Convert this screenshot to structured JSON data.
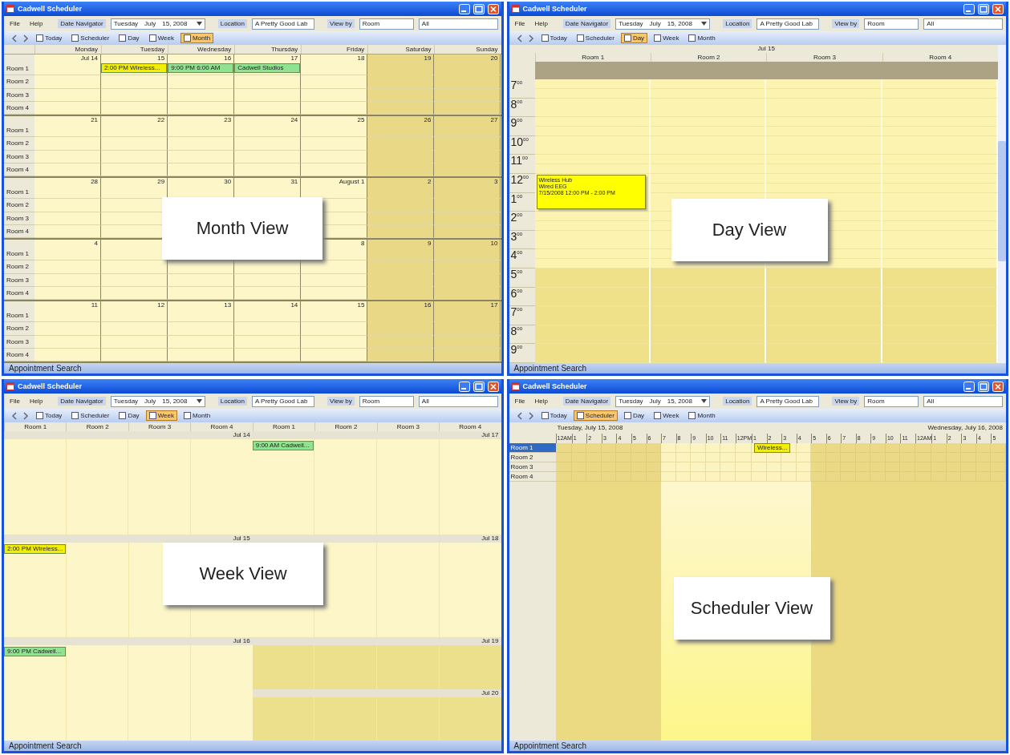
{
  "windows": [
    {
      "title": "Cadwell Scheduler",
      "menu": [
        "File",
        "Help"
      ],
      "date_navigator": {
        "label": "Date Navigator",
        "day": "Tuesday",
        "month": "July",
        "date": "15, 2008"
      },
      "location": {
        "label": "Location",
        "value": "A Pretty Good Lab"
      },
      "view_by": {
        "label": "View by",
        "value": "Room",
        "filter": "All"
      },
      "views": [
        {
          "label": "Today",
          "selected": false
        },
        {
          "label": "Scheduler",
          "selected": false
        },
        {
          "label": "Day",
          "selected": false
        },
        {
          "label": "Week",
          "selected": false
        },
        {
          "label": "Month",
          "selected": true
        }
      ],
      "view": {
        "kind": "month",
        "days": [
          {
            "name": "Monday",
            "weekend": false
          },
          {
            "name": "Tuesday",
            "weekend": false
          },
          {
            "name": "Wednesday",
            "weekend": false
          },
          {
            "name": "Thursday",
            "weekend": false
          },
          {
            "name": "Friday",
            "weekend": false
          },
          {
            "name": "Saturday",
            "weekend": true
          },
          {
            "name": "Sunday",
            "weekend": true
          }
        ],
        "weeks": [
          {
            "dates": [
              "Jul 14",
              "15",
              "16",
              "17",
              "18",
              "19",
              "20"
            ],
            "rooms": [
              {
                "name": "Room 1",
                "cells": [
                  {
                    "kind": "free"
                  },
                  {
                    "kind": "appointment",
                    "text": "2:00 PM Wireless...",
                    "color": "#f2f000"
                  },
                  {
                    "kind": "appointment",
                    "text": "9:00 PM 6:00 AM",
                    "color": "#8fe28f"
                  },
                  {
                    "kind": "appointment",
                    "text": "Cadwell Studios",
                    "color": "#8fe28f"
                  },
                  {
                    "kind": "free"
                  },
                  {
                    "kind": "free"
                  },
                  {
                    "kind": "free"
                  }
                ]
              },
              {
                "name": "Room 2"
              },
              {
                "name": "Room 3"
              },
              {
                "name": "Room 4"
              }
            ]
          },
          {
            "dates": [
              "21",
              "22",
              "23",
              "24",
              "25",
              "26",
              "27"
            ],
            "rooms": [
              {
                "name": "Room 1"
              },
              {
                "name": "Room 2"
              },
              {
                "name": "Room 3"
              },
              {
                "name": "Room 4"
              }
            ]
          },
          {
            "dates": [
              "28",
              "29",
              "30",
              "31",
              "August 1",
              "2",
              "3"
            ],
            "rooms": [
              {
                "name": "Room 1"
              },
              {
                "name": "Room 2",
                "cells": [
                  {
                    "kind": "free"
                  },
                  {
                    "kind": "free"
                  },
                  {
                    "kind": "covered"
                  },
                  {
                    "kind": "covered"
                  },
                  {
                    "kind": "free"
                  },
                  {
                    "kind": "free"
                  },
                  {
                    "kind": "free"
                  }
                ]
              },
              {
                "name": "Room 3",
                "cells": [
                  {
                    "kind": "free"
                  },
                  {
                    "kind": "free"
                  },
                  {
                    "kind": "covered"
                  },
                  {
                    "kind": "covered"
                  },
                  {
                    "kind": "free"
                  },
                  {
                    "kind": "free"
                  },
                  {
                    "kind": "free"
                  }
                ]
              },
              {
                "name": "Room 4"
              }
            ]
          },
          {
            "dates": [
              {
                "kind": "date",
                "label": "4"
              },
              {
                "kind": "covered"
              },
              {
                "kind": "covered"
              },
              {
                "kind": "covered"
              },
              {
                "kind": "date",
                "label": "8"
              },
              {
                "kind": "date",
                "label": "9"
              },
              {
                "kind": "date",
                "label": "10"
              }
            ],
            "rooms": [
              {
                "name": "Room 1"
              },
              {
                "name": "Room 2"
              },
              {
                "name": "Room 3"
              },
              {
                "name": "Room 4"
              }
            ]
          },
          {
            "dates": [
              "11",
              "12",
              "13",
              "14",
              "15",
              "16",
              "17"
            ],
            "rooms": [
              {
                "name": "Room 1"
              },
              {
                "name": "Room 2"
              },
              {
                "name": "Room 3"
              },
              {
                "name": "Room 4"
              }
            ]
          }
        ]
      },
      "callout": "Month View",
      "status": "Appointment Search"
    },
    {
      "title": "Cadwell Scheduler",
      "menu": [
        "File",
        "Help"
      ],
      "date_navigator": {
        "label": "Date Navigator",
        "day": "Tuesday",
        "month": "July",
        "date": "15, 2008"
      },
      "location": {
        "label": "Location",
        "value": "A Pretty Good Lab"
      },
      "view_by": {
        "label": "View by",
        "value": "Room",
        "filter": "All"
      },
      "views": [
        {
          "label": "Today",
          "selected": false
        },
        {
          "label": "Scheduler",
          "selected": false
        },
        {
          "label": "Day",
          "selected": true
        },
        {
          "label": "Week",
          "selected": false
        },
        {
          "label": "Month",
          "selected": false
        }
      ],
      "view": {
        "kind": "day",
        "date": "Jul 15",
        "rooms": [
          "Room 1",
          "Room 2",
          "Room 3",
          "Room 4"
        ],
        "hours": [
          {
            "label": "7$^{00}$",
            "after_hours": false
          },
          {
            "label": "8$^{00}$",
            "after_hours": false
          },
          {
            "label": "9$^{00}$",
            "after_hours": false
          },
          {
            "label": "10$^{00}$",
            "after_hours": false
          },
          {
            "label": "11$^{00}$",
            "after_hours": false
          },
          {
            "label": "12$^{00}$",
            "after_hours": false,
            "slots": [
              {
                "kind": "appointment",
                "lines": [
                  "Wireless Hub",
                  "Wired EEG",
                  "7/15/2008 12:00 PM - 2:00 PM"
                ],
                "color": "#ffff00"
              },
              {
                "kind": "free"
              },
              {
                "kind": "free"
              },
              {
                "kind": "free"
              }
            ]
          },
          {
            "label": "1$^{00}$",
            "after_hours": false
          },
          {
            "label": "2$^{00}$",
            "after_hours": false
          },
          {
            "label": "3$^{00}$",
            "after_hours": false
          },
          {
            "label": "4$^{00}$",
            "after_hours": false
          },
          {
            "label": "5$^{00}$",
            "after_hours": true
          },
          {
            "label": "6$^{00}$",
            "after_hours": true
          },
          {
            "label": "7$^{00}$",
            "after_hours": true
          },
          {
            "label": "8$^{00}$",
            "after_hours": true
          },
          {
            "label": "9$^{00}$",
            "after_hours": true
          }
        ]
      },
      "callout": "Day View",
      "status": "Appointment Search"
    },
    {
      "title": "Cadwell Scheduler",
      "menu": [
        "File",
        "Help"
      ],
      "date_navigator": {
        "label": "Date Navigator",
        "day": "Tuesday",
        "month": "July",
        "date": "15, 2008"
      },
      "location": {
        "label": "Location",
        "value": "A Pretty Good Lab"
      },
      "view_by": {
        "label": "View by",
        "value": "Room",
        "filter": "All"
      },
      "views": [
        {
          "label": "Today",
          "selected": false
        },
        {
          "label": "Scheduler",
          "selected": false
        },
        {
          "label": "Day",
          "selected": false
        },
        {
          "label": "Week",
          "selected": true
        },
        {
          "label": "Month",
          "selected": false
        }
      ],
      "view": {
        "kind": "week",
        "rooms": [
          "Room 1",
          "Room 2",
          "Room 3",
          "Room 4",
          "Room 1",
          "Room 2",
          "Room 3",
          "Room 4"
        ],
        "sections": [
          {
            "left": {
              "date": "Jul 14",
              "weekend": false
            },
            "right": [
              {
                "date": "Jul 17",
                "weekend": false,
                "cells": [
                  {
                    "kind": "appointment",
                    "text": "9:00 AM   Cadwell...",
                    "color": "#8fe28f"
                  },
                  {
                    "kind": "free"
                  },
                  {
                    "kind": "free"
                  },
                  {
                    "kind": "free"
                  }
                ]
              }
            ]
          },
          {
            "left": {
              "date": "Jul 15",
              "weekend": false,
              "cells": [
                {
                  "kind": "appointment",
                  "text": "2:00 PM Wireless...",
                  "color": "#f2f000"
                },
                {
                  "kind": "free"
                },
                {
                  "kind": "free"
                },
                {
                  "kind": "free"
                }
              ]
            },
            "right": [
              {
                "date": "Jul 18",
                "weekend": false
              }
            ]
          },
          {
            "left": {
              "date": "Jul 16",
              "weekend": false,
              "cells": [
                {
                  "kind": "appointment",
                  "text": "9:00 PM   Cadwell...",
                  "color": "#8fe28f"
                },
                {
                  "kind": "free"
                },
                {
                  "kind": "free"
                },
                {
                  "kind": "free"
                }
              ]
            },
            "right": [
              {
                "date": "Jul 19",
                "weekend": true
              },
              {
                "date": "Jul 20",
                "weekend": true
              }
            ]
          }
        ]
      },
      "callout": "Week View",
      "status": "Appointment Search"
    },
    {
      "title": "Cadwell Scheduler",
      "menu": [
        "File",
        "Help"
      ],
      "date_navigator": {
        "label": "Date Navigator",
        "day": "Tuesday",
        "month": "July",
        "date": "15, 2008"
      },
      "location": {
        "label": "Location",
        "value": "A Pretty Good Lab"
      },
      "view_by": {
        "label": "View by",
        "value": "Room",
        "filter": "All"
      },
      "views": [
        {
          "label": "Today",
          "selected": false
        },
        {
          "label": "Scheduler",
          "selected": true
        },
        {
          "label": "Day",
          "selected": false
        },
        {
          "label": "Week",
          "selected": false
        },
        {
          "label": "Month",
          "selected": false
        }
      ],
      "view": {
        "kind": "scheduler",
        "rooms": [
          {
            "name": "Room 1",
            "selected": true
          },
          {
            "name": "Room 2",
            "selected": false
          },
          {
            "name": "Room 3",
            "selected": false
          },
          {
            "name": "Room 4",
            "selected": false
          }
        ],
        "days": [
          {
            "label": "Tuesday, July 15, 2008",
            "hours": [
              {
                "label": "12AM",
                "working": false
              },
              {
                "label": "1",
                "working": false
              },
              {
                "label": "2",
                "working": false
              },
              {
                "label": "3",
                "working": false
              },
              {
                "label": "4",
                "working": false
              },
              {
                "label": "5",
                "working": false
              },
              {
                "label": "6",
                "working": false
              },
              {
                "label": "7",
                "working": true
              },
              {
                "label": "8",
                "working": true
              },
              {
                "label": "9",
                "working": true
              },
              {
                "label": "10",
                "working": true
              },
              {
                "label": "11",
                "working": true
              },
              {
                "label": "12PM",
                "working": true
              },
              {
                "label": "1",
                "working": true,
                "appointment": {
                  "text": "Wireless...",
                  "color": "#f2f000"
                }
              },
              {
                "label": "2",
                "working": true
              },
              {
                "label": "3",
                "working": true
              },
              {
                "label": "4",
                "working": true
              },
              {
                "label": "5",
                "working": false
              },
              {
                "label": "6",
                "working": false
              },
              {
                "label": "7",
                "working": false
              },
              {
                "label": "8",
                "working": false
              },
              {
                "label": "9",
                "working": false
              },
              {
                "label": "10",
                "working": false
              },
              {
                "label": "11",
                "working": false
              }
            ]
          },
          {
            "label": "Wednesday, July 16, 2008",
            "hours": [
              {
                "label": "12AM",
                "working": false
              },
              {
                "label": "1",
                "working": false
              },
              {
                "label": "2",
                "working": false
              },
              {
                "label": "3",
                "working": false
              },
              {
                "label": "4",
                "working": false
              },
              {
                "label": "5",
                "working": false
              }
            ]
          }
        ]
      },
      "callout": "Scheduler View",
      "status": "Appointment Search"
    }
  ]
}
